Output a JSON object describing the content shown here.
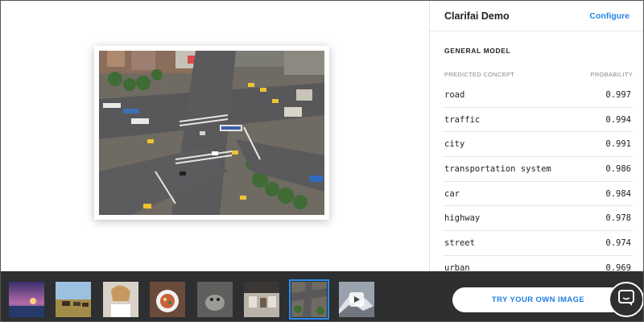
{
  "header": {
    "title": "Clarifai Demo",
    "configure_label": "Configure"
  },
  "model": {
    "name": "GENERAL MODEL",
    "col_concept": "PREDICTED CONCEPT",
    "col_probability": "PROBABILITY"
  },
  "predictions": [
    {
      "concept": "road",
      "probability": "0.997"
    },
    {
      "concept": "traffic",
      "probability": "0.994"
    },
    {
      "concept": "city",
      "probability": "0.991"
    },
    {
      "concept": "transportation system",
      "probability": "0.986"
    },
    {
      "concept": "car",
      "probability": "0.984"
    },
    {
      "concept": "highway",
      "probability": "0.978"
    },
    {
      "concept": "street",
      "probability": "0.974"
    },
    {
      "concept": "urban",
      "probability": "0.969"
    }
  ],
  "thumbnails": [
    {
      "name": "thumb-sunset",
      "selected": false
    },
    {
      "name": "thumb-savanna",
      "selected": false
    },
    {
      "name": "thumb-woman",
      "selected": false
    },
    {
      "name": "thumb-food",
      "selected": false
    },
    {
      "name": "thumb-animal",
      "selected": false
    },
    {
      "name": "thumb-kitchen",
      "selected": false
    },
    {
      "name": "thumb-intersection",
      "selected": true
    },
    {
      "name": "thumb-mountain-video",
      "selected": false
    }
  ],
  "actions": {
    "try_label": "TRY YOUR OWN IMAGE"
  },
  "icons": {
    "chat": "chat-icon",
    "play": "play-icon"
  },
  "colors": {
    "accent": "#1e88e5",
    "bottom_bar": "#2d2f31",
    "selected_outline": "#2b8cf0"
  }
}
